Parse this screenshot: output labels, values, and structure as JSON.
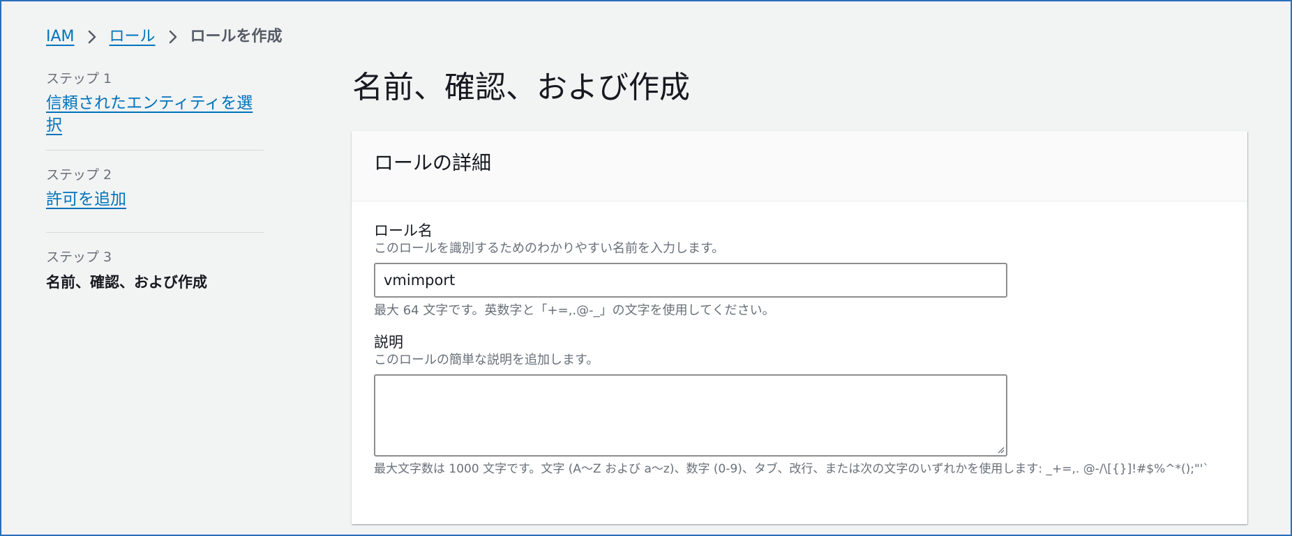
{
  "breadcrumb": {
    "items": [
      {
        "label": "IAM"
      },
      {
        "label": "ロール"
      }
    ],
    "current": "ロールを作成"
  },
  "steps": [
    {
      "step_label": "ステップ 1",
      "title": "信頼されたエンティティを選択"
    },
    {
      "step_label": "ステップ 2",
      "title": "許可を追加"
    },
    {
      "step_label": "ステップ 3",
      "title": "名前、確認、および作成"
    }
  ],
  "page": {
    "title": "名前、確認、および作成"
  },
  "role_details": {
    "header": "ロールの詳細",
    "role_name": {
      "label": "ロール名",
      "description": "このロールを識別するためのわかりやすい名前を入力します。",
      "value": "vmimport",
      "constraint": "最大 64 文字です。英数字と「+=,.@-_」の文字を使用してください。"
    },
    "description_field": {
      "label": "説明",
      "description": "このロールの簡単な説明を追加します。",
      "value": "",
      "constraint": "最大文字数は 1000 文字です。文字 (A～Z および a～z)、数字 (0-9)、タブ、改行、または次の文字のいずれかを使用します: _+=,. @-/\\[{}]!#$%^*();\"'`"
    }
  },
  "colors": {
    "link": "#0073bb",
    "frame_border": "#2a6ebb",
    "background": "#f2f3f3"
  },
  "icons": {
    "separator": "chevron-right-icon",
    "resize": "resize-handle-icon"
  }
}
